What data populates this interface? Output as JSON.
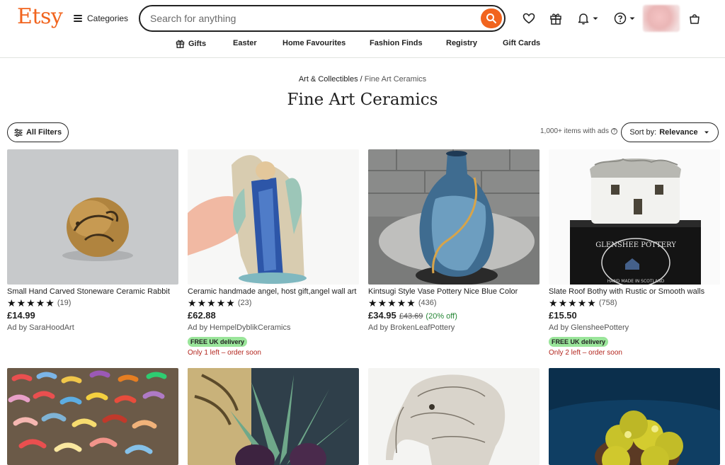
{
  "header": {
    "logo": "Etsy",
    "categories_label": "Categories",
    "search_placeholder": "Search for anything",
    "accent": "#f1641e",
    "icons": [
      "heart-icon",
      "gift-icon",
      "bell-icon",
      "help-icon",
      "cart-icon"
    ]
  },
  "nav": {
    "items": [
      "Gifts",
      "Easter",
      "Home Favourites",
      "Fashion Finds",
      "Registry",
      "Gift Cards"
    ]
  },
  "breadcrumb": {
    "parent": "Art & Collectibles",
    "separator": "/",
    "current": "Fine Art Ceramics"
  },
  "page_title": "Fine Art Ceramics",
  "toolbar": {
    "filters_label": "All Filters",
    "result_count": "1,000+ items with ads",
    "sort_prefix": "Sort by:",
    "sort_value": "Relevance"
  },
  "listings": [
    {
      "name": "Small Hand Carved Stoneware Ceramic Rabbit",
      "rating": 5,
      "reviews": "(19)",
      "price": "£14.99",
      "seller": "Ad by SaraHoodArt"
    },
    {
      "name": "Ceramic handmade angel, host gift,angel wall art",
      "rating": 5,
      "reviews": "(23)",
      "price": "£62.88",
      "seller": "Ad by HempelDyblikCeramics",
      "badge": "FREE UK delivery",
      "stock": "Only 1 left – order soon"
    },
    {
      "name": "Kintsugi Style Vase Pottery Nice Blue Color",
      "rating": 5,
      "reviews": "(436)",
      "price": "£34.95",
      "original_price": "£43.69",
      "discount": "(20% off)",
      "seller": "Ad by BrokenLeafPottery"
    },
    {
      "name": "Slate Roof Bothy with Rustic or Smooth walls",
      "rating": 5,
      "reviews": "(758)",
      "price": "£15.50",
      "seller": "Ad by GlensheePottery",
      "badge": "FREE UK delivery",
      "stock": "Only 2 left – order soon"
    }
  ],
  "box_text": {
    "line1": "GLENSHEE POTTERY",
    "line2": "HAND MADE IN SCOTLAND"
  }
}
